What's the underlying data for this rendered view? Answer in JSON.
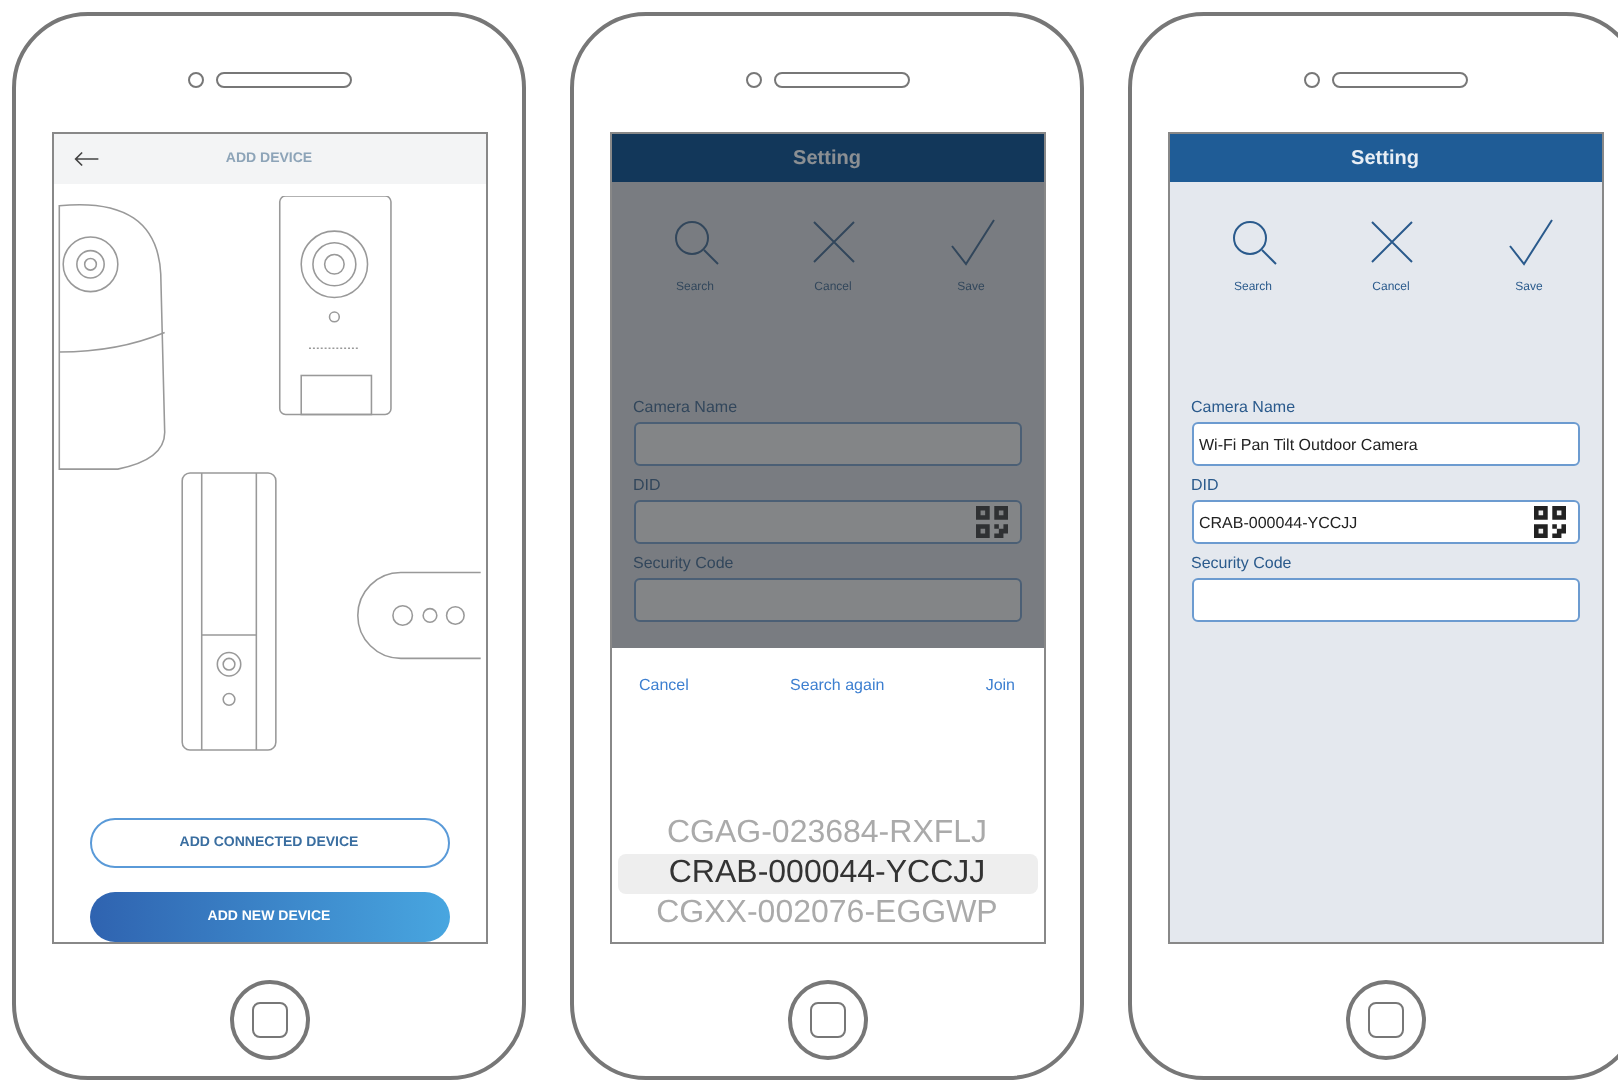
{
  "phones": [
    {
      "kind": "add_device",
      "header": {
        "title": "ADD DEVICE"
      },
      "buttons": [
        {
          "label": "ADD CONNECTED DEVICE",
          "kind": "outline"
        },
        {
          "label": "ADD NEW DEVICE",
          "kind": "filled"
        }
      ]
    },
    {
      "kind": "setting",
      "dimmed": true,
      "header": {
        "title": "Setting"
      },
      "actions": [
        {
          "label": "Search",
          "kind": "search"
        },
        {
          "label": "Cancel",
          "kind": "cancel"
        },
        {
          "label": "Save",
          "kind": "save"
        }
      ],
      "fields": [
        {
          "label": "Camera Name",
          "has_qr": false
        },
        {
          "label": "DID",
          "has_qr": true
        },
        {
          "label": "Security Code",
          "has_qr": false
        }
      ],
      "sheet": {
        "actions": [
          "Cancel",
          "Search again",
          "Join"
        ],
        "options": [
          {
            "text": "CGAG-023684-RXFLJ",
            "selected": false
          },
          {
            "text": "CRAB-000044-YCCJJ",
            "selected": true
          },
          {
            "text": "CGXX-002076-EGGWP",
            "selected": false
          }
        ]
      }
    },
    {
      "kind": "setting",
      "dimmed": false,
      "header": {
        "title": "Setting"
      },
      "actions": [
        {
          "label": "Search",
          "kind": "search"
        },
        {
          "label": "Cancel",
          "kind": "cancel"
        },
        {
          "label": "Save",
          "kind": "save"
        }
      ],
      "fields": [
        {
          "label": "Camera Name",
          "value": "Wi-Fi Pan Tilt Outdoor Camera",
          "has_qr": false
        },
        {
          "label": "DID",
          "value": "CRAB-000044-YCCJJ",
          "has_qr": true
        },
        {
          "label": "Security Code",
          "has_qr": false
        }
      ]
    }
  ]
}
